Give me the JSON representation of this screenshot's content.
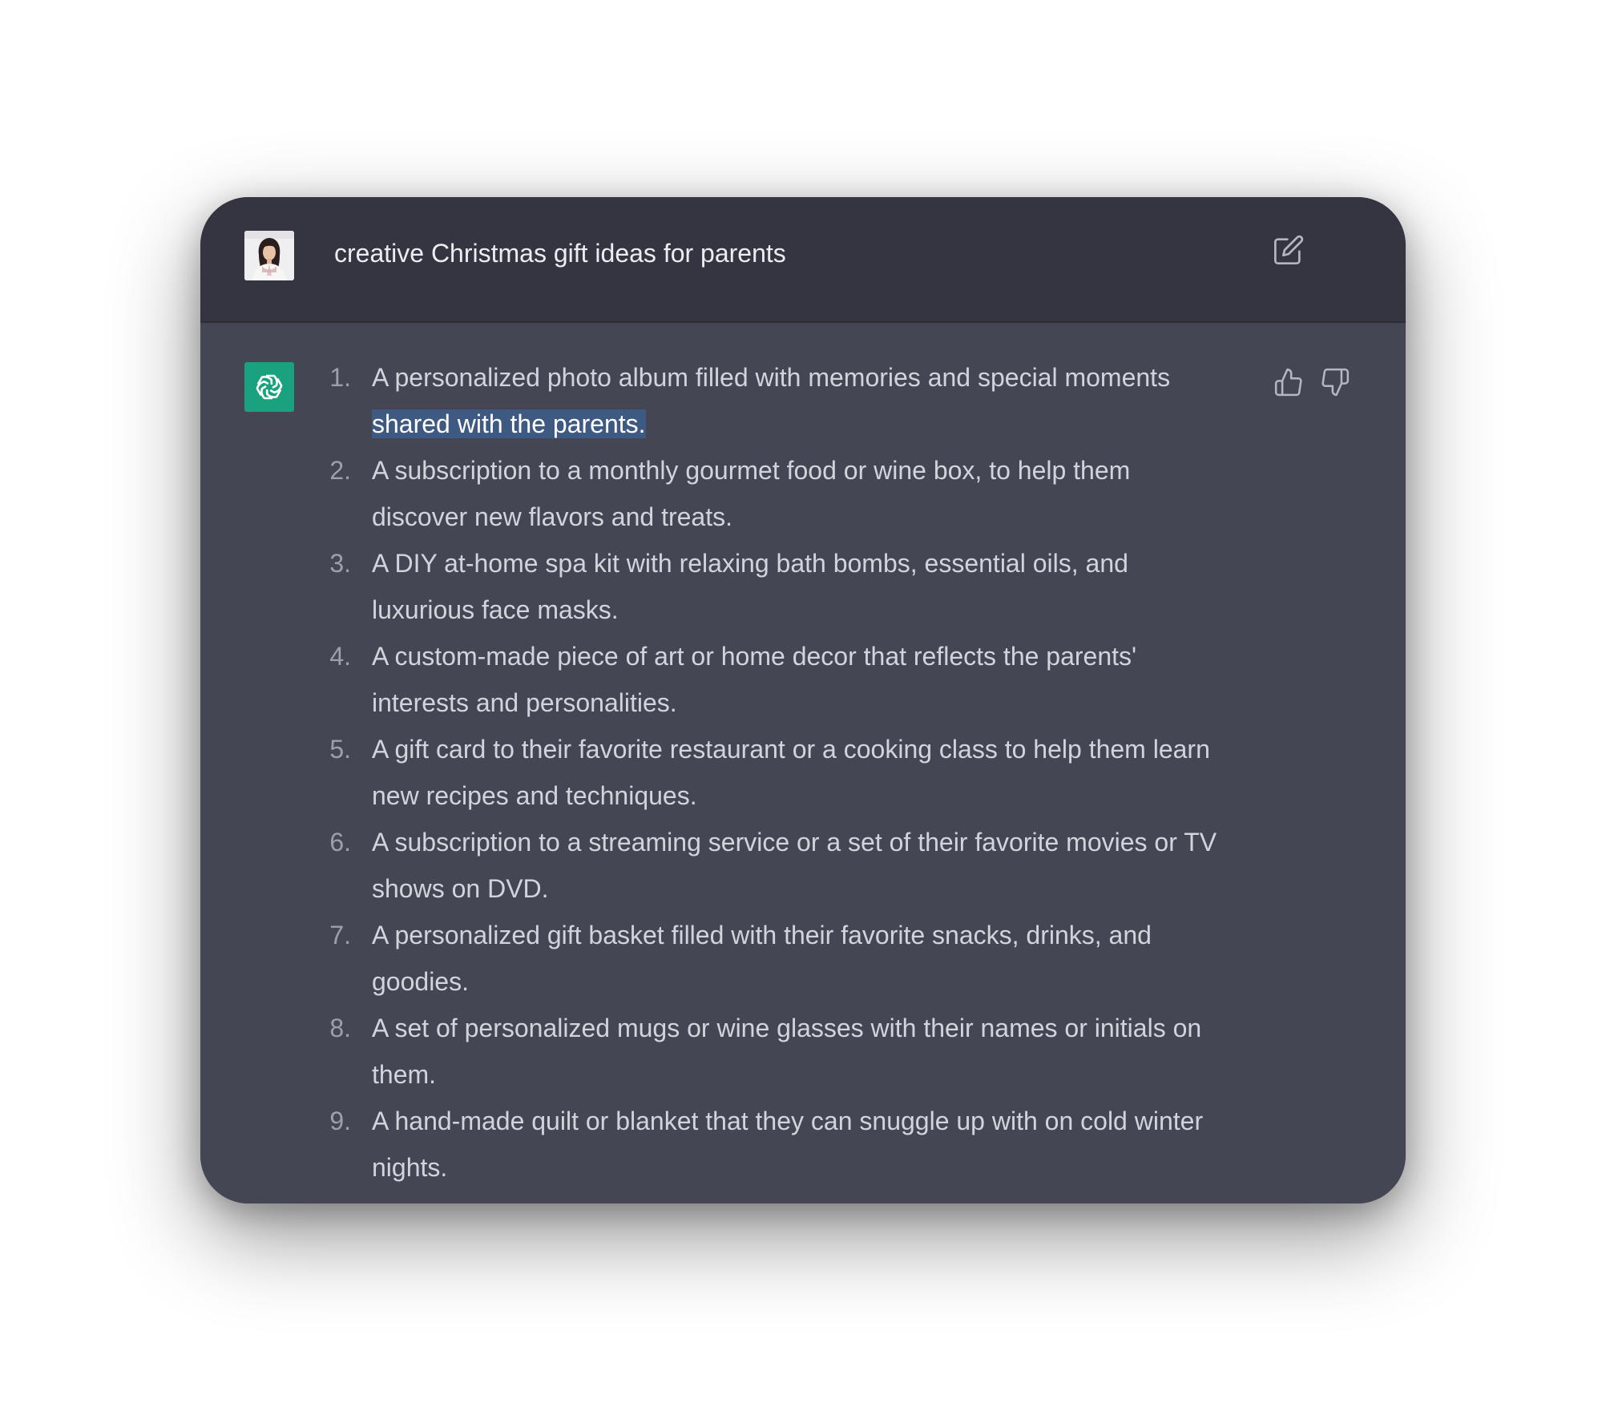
{
  "conversation": {
    "prompt": "creative Christmas gift ideas for parents",
    "user_avatar": "user-photo",
    "bot_avatar": "chatgpt-logo-icon",
    "response": {
      "items": [
        {
          "num": "1.",
          "text": "A personalized photo album filled with memories and special moments ",
          "highlight": "shared with the parents."
        },
        {
          "num": "2.",
          "text": "A subscription to a monthly gourmet food or wine box, to help them discover new flavors and treats."
        },
        {
          "num": "3.",
          "text": "A DIY at-home spa kit with relaxing bath bombs, essential oils, and luxurious face masks."
        },
        {
          "num": "4.",
          "text": "A custom-made piece of art or home decor that reflects the parents' interests and personalities."
        },
        {
          "num": "5.",
          "text": "A gift card to their favorite restaurant or a cooking class to help them learn new recipes and techniques."
        },
        {
          "num": "6.",
          "text": "A subscription to a streaming service or a set of their favorite movies or TV shows on DVD."
        },
        {
          "num": "7.",
          "text": "A personalized gift basket filled with their favorite snacks, drinks, and goodies."
        },
        {
          "num": "8.",
          "text": "A set of personalized mugs or wine glasses with their names or initials on them."
        },
        {
          "num": "9.",
          "text": "A hand-made quilt or blanket that they can snuggle up with on cold winter nights."
        }
      ]
    }
  },
  "icons": {
    "edit": "edit-icon",
    "thumbs_up": "thumbs-up-icon",
    "thumbs_down": "thumbs-down-icon"
  },
  "colors": {
    "header_bg": "#343541",
    "body_bg": "#444654",
    "bot_avatar_bg": "#19a27d",
    "selection_bg": "#3f5a82",
    "text": "#d1d5db"
  }
}
